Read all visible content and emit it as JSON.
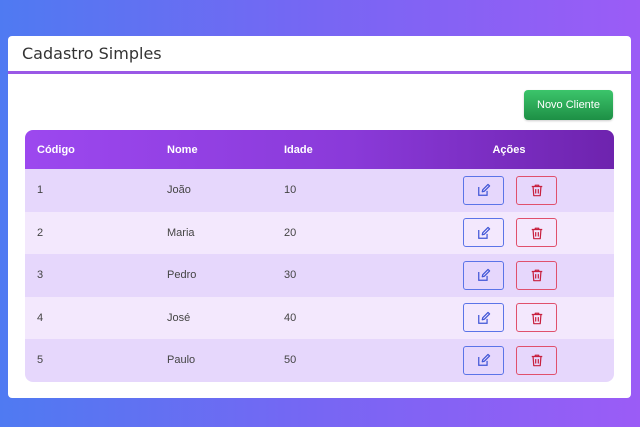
{
  "header": {
    "title": "Cadastro Simples"
  },
  "toolbar": {
    "new_label": "Novo Cliente"
  },
  "table": {
    "columns": [
      "Código",
      "Nome",
      "Idade",
      "Ações"
    ],
    "rows": [
      {
        "codigo": "1",
        "nome": "João",
        "idade": "10"
      },
      {
        "codigo": "2",
        "nome": "Maria",
        "idade": "20"
      },
      {
        "codigo": "3",
        "nome": "Pedro",
        "idade": "30"
      },
      {
        "codigo": "4",
        "nome": "José",
        "idade": "40"
      },
      {
        "codigo": "5",
        "nome": "Paulo",
        "idade": "50"
      }
    ],
    "row_actions": [
      "edit-icon",
      "trash-icon"
    ]
  },
  "colors": {
    "accent": "#9a58e6",
    "header_gradient_start": "#9c48ef",
    "header_gradient_end": "#6e23ae",
    "new_button": "#2ea85a",
    "edit": "#5b74e8",
    "delete": "#e0506c"
  }
}
